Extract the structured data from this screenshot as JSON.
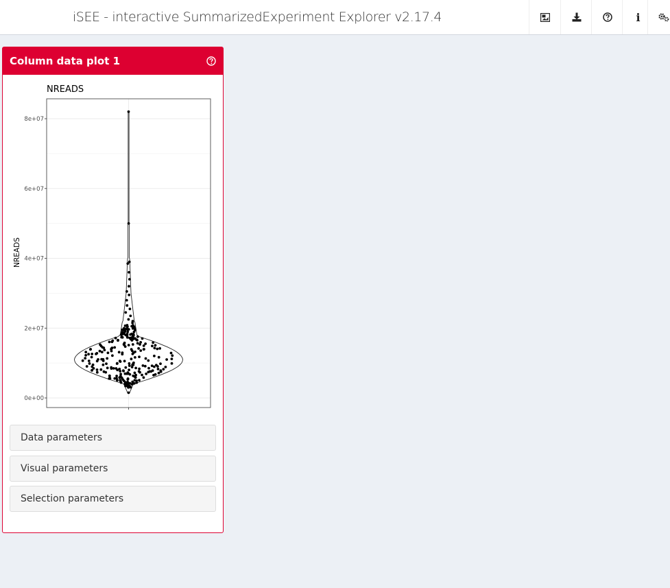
{
  "app": {
    "title": "iSEE - interactive SummarizedExperiment Explorer v2.17.4"
  },
  "header_icons": [
    "image-icon",
    "download-icon",
    "help-icon",
    "info-icon",
    "settings-icon"
  ],
  "header_info_glyph": "i",
  "panel": {
    "title": "Column data plot 1",
    "header_color": "#dd0031",
    "sections": [
      {
        "label": "Data parameters"
      },
      {
        "label": "Visual parameters"
      },
      {
        "label": "Selection parameters"
      }
    ]
  },
  "chart_data": {
    "type": "violin",
    "title": "NREADS",
    "xlabel": "",
    "ylabel": "NREADS",
    "ylim": [
      -2500000,
      85000000
    ],
    "yticks": [
      0,
      20000000,
      40000000,
      60000000,
      80000000
    ],
    "ytick_labels": [
      "0e+00",
      "2e+07",
      "4e+07",
      "6e+07",
      "8e+07"
    ],
    "grid": true,
    "summary": {
      "min": 1500000,
      "mode": 11000000,
      "max": 82000000
    },
    "outliers": [
      50000000,
      39000000,
      38500000,
      36000000,
      34000000,
      32000000,
      30500000,
      29500000,
      28000000,
      26500000,
      25500000,
      24500000,
      23500000,
      22500000,
      22000000,
      21500000
    ]
  }
}
